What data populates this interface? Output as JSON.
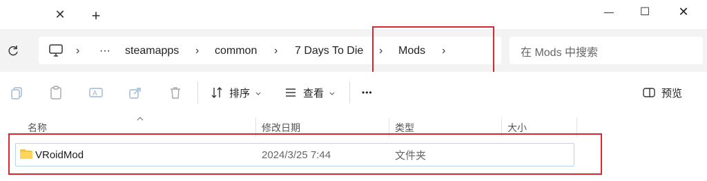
{
  "window": {
    "tab_close_glyph": "✕",
    "tab_new_glyph": "+",
    "minimize_glyph": "—",
    "maximize_glyph": "☐",
    "close_glyph": "✕"
  },
  "address": {
    "ellipsis": "···",
    "sep": "›",
    "crumbs": [
      "steamapps",
      "common",
      "7 Days To Die",
      "Mods"
    ]
  },
  "search": {
    "placeholder": "在 Mods 中搜索"
  },
  "toolbar": {
    "sort_label": "排序",
    "view_label": "查看",
    "more_glyph": "•••",
    "preview_label": "预览"
  },
  "columns": {
    "name": "名称",
    "modified": "修改日期",
    "type": "类型",
    "size": "大小"
  },
  "rows": [
    {
      "name": "VRoidMod",
      "modified": "2024/3/25 7:44",
      "type": "文件夹"
    }
  ],
  "colors": {
    "highlight": "#d8262f",
    "folder": "#f4c542",
    "selection_border": "#b9d3ee"
  }
}
